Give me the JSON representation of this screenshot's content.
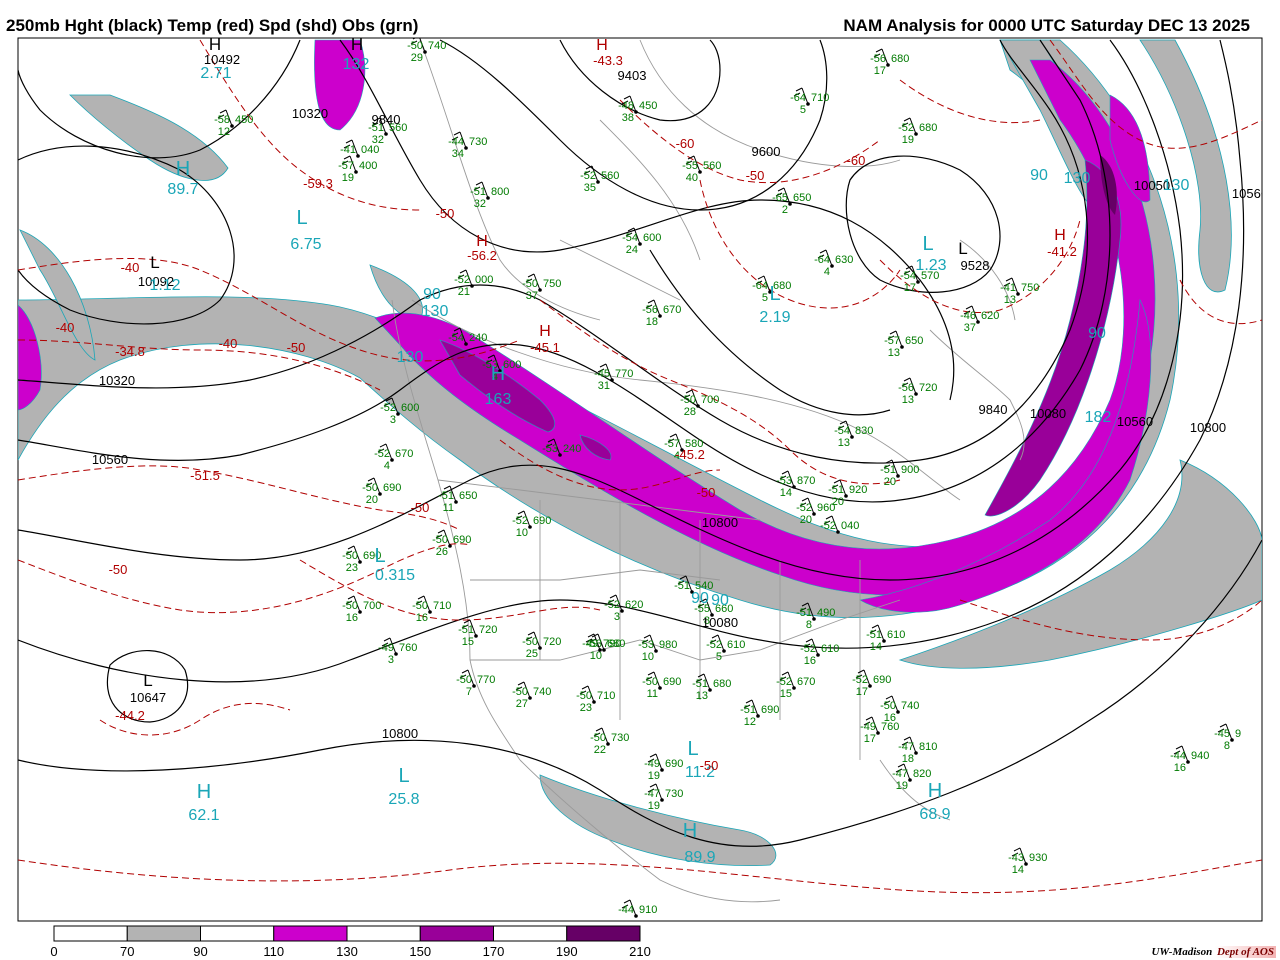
{
  "header": {
    "title_left": "250mb Hght (black) Temp (red) Spd (shd) Obs (grn)",
    "title_right": "NAM Analysis for 0000 UTC Saturday  DEC 13 2025"
  },
  "colors": {
    "height": "#000000",
    "temperature": "#b00000",
    "obs": "#007a00",
    "speed_label": "#1aa6b7",
    "speed_70": "#b3b3b3",
    "speed_110": "#cc00cc",
    "speed_150": "#990099",
    "speed_190": "#660066",
    "borders": "#9a9a9a"
  },
  "legend": {
    "ticks": [
      "0",
      "70",
      "90",
      "110",
      "130",
      "150",
      "170",
      "190",
      "210"
    ],
    "fills": [
      "#ffffff",
      "#b3b3b3",
      "#ffffff",
      "#cc00cc",
      "#ffffff",
      "#990099",
      "#ffffff",
      "#660066",
      "#ffffff"
    ]
  },
  "credit": {
    "org": "UW-Madison",
    "dept": "Dept of AOS"
  },
  "centers": [
    {
      "text": "H",
      "kind": "height"
    },
    {
      "text": "10492",
      "kind": "height"
    },
    {
      "text": "2.71",
      "kind": "speed"
    },
    {
      "text": "H",
      "kind": "speed"
    },
    {
      "text": "89.7",
      "kind": "speed"
    },
    {
      "text": "L",
      "kind": "speed"
    },
    {
      "text": "6.75",
      "kind": "speed"
    },
    {
      "text": "L",
      "kind": "height"
    },
    {
      "text": "10092",
      "kind": "height"
    },
    {
      "text": "1.12",
      "kind": "speed"
    },
    {
      "text": "10320",
      "kind": "height"
    },
    {
      "text": "10320",
      "kind": "height"
    },
    {
      "text": "10560",
      "kind": "height"
    },
    {
      "text": "L",
      "kind": "height"
    },
    {
      "text": "10647",
      "kind": "height"
    },
    {
      "text": "10800",
      "kind": "height"
    },
    {
      "text": "H",
      "kind": "speed"
    },
    {
      "text": "62.1",
      "kind": "speed"
    },
    {
      "text": "L",
      "kind": "speed"
    },
    {
      "text": "25.8",
      "kind": "speed"
    },
    {
      "text": "H",
      "kind": "speed"
    },
    {
      "text": "163",
      "kind": "speed"
    },
    {
      "text": "L",
      "kind": "speed"
    },
    {
      "text": "0.315",
      "kind": "speed"
    },
    {
      "text": "9600",
      "kind": "height"
    },
    {
      "text": "L",
      "kind": "speed"
    },
    {
      "text": "2.19",
      "kind": "speed"
    },
    {
      "text": "L",
      "kind": "speed"
    },
    {
      "text": "1.23",
      "kind": "speed"
    },
    {
      "text": "L",
      "kind": "height"
    },
    {
      "text": "9528",
      "kind": "height"
    },
    {
      "text": "9840",
      "kind": "height"
    },
    {
      "text": "10080",
      "kind": "height"
    },
    {
      "text": "10560",
      "kind": "height"
    },
    {
      "text": "10800",
      "kind": "height"
    },
    {
      "text": "10050",
      "kind": "height"
    },
    {
      "text": "10560",
      "kind": "height"
    },
    {
      "text": "10800",
      "kind": "height"
    },
    {
      "text": "10080",
      "kind": "height"
    },
    {
      "text": "L",
      "kind": "speed"
    },
    {
      "text": "11.2",
      "kind": "speed"
    },
    {
      "text": "H",
      "kind": "speed"
    },
    {
      "text": "89.9",
      "kind": "speed"
    },
    {
      "text": "H",
      "kind": "speed"
    },
    {
      "text": "68.9",
      "kind": "speed"
    },
    {
      "text": "9403",
      "kind": "height"
    },
    {
      "text": "9840",
      "kind": "height"
    },
    {
      "text": "H",
      "kind": "height"
    },
    {
      "text": "132",
      "kind": "speed"
    },
    {
      "text": "90",
      "kind": "speed"
    },
    {
      "text": "130",
      "kind": "speed"
    },
    {
      "text": "130",
      "kind": "speed"
    },
    {
      "text": "90",
      "kind": "speed"
    },
    {
      "text": "130",
      "kind": "speed"
    },
    {
      "text": "90",
      "kind": "speed"
    },
    {
      "text": "182",
      "kind": "speed"
    },
    {
      "text": "130",
      "kind": "speed"
    },
    {
      "text": "90",
      "kind": "speed"
    },
    {
      "text": "90",
      "kind": "speed"
    }
  ],
  "temps": [
    {
      "text": "-40"
    },
    {
      "text": "-34.8"
    },
    {
      "text": "-40"
    },
    {
      "text": "-40"
    },
    {
      "text": "-50"
    },
    {
      "text": "-51.5"
    },
    {
      "text": "-50"
    },
    {
      "text": "-50"
    },
    {
      "text": "-44.2"
    },
    {
      "text": "-59.3"
    },
    {
      "text": "H"
    },
    {
      "text": "-45.1"
    },
    {
      "text": "H"
    },
    {
      "text": "-56.2"
    },
    {
      "text": "-60"
    },
    {
      "text": "-50"
    },
    {
      "text": "-60"
    },
    {
      "text": "-50"
    },
    {
      "text": "-45.2"
    },
    {
      "text": "-50"
    },
    {
      "text": "H"
    },
    {
      "text": "-41.2"
    },
    {
      "text": "H"
    },
    {
      "text": "-43.3"
    },
    {
      "text": "-50"
    }
  ],
  "obs": [
    {
      "top": "-50",
      "hgt": "740",
      "bot": "29"
    },
    {
      "top": "-58",
      "hgt": "450",
      "bot": "12"
    },
    {
      "top": "-51",
      "hgt": "560",
      "bot": "32"
    },
    {
      "top": "-44",
      "hgt": "730",
      "bot": "34"
    },
    {
      "top": "-52",
      "hgt": "560",
      "bot": "35"
    },
    {
      "top": "-51",
      "hgt": "800",
      "bot": "32"
    },
    {
      "top": "-52",
      "hgt": "000",
      "bot": "21"
    },
    {
      "top": "-50",
      "hgt": "750",
      "bot": "37"
    },
    {
      "top": "-48",
      "hgt": "450",
      "bot": "38"
    },
    {
      "top": "-55",
      "hgt": "560",
      "bot": "40"
    },
    {
      "top": "-54",
      "hgt": "600",
      "bot": "24"
    },
    {
      "top": "-56",
      "hgt": "680",
      "bot": "17"
    },
    {
      "top": "-64",
      "hgt": "710",
      "bot": "5"
    },
    {
      "top": "-52",
      "hgt": "680",
      "bot": "19"
    },
    {
      "top": "-65",
      "hgt": "650",
      "bot": "2"
    },
    {
      "top": "-64",
      "hgt": "680",
      "bot": "5"
    },
    {
      "top": "-64",
      "hgt": "630",
      "bot": "4"
    },
    {
      "top": "-54",
      "hgt": "570",
      "bot": "17"
    },
    {
      "top": "-56",
      "hgt": "670",
      "bot": "18"
    },
    {
      "top": "-45",
      "hgt": "770",
      "bot": "31"
    },
    {
      "top": "-50",
      "hgt": "700",
      "bot": "28"
    },
    {
      "top": "-52",
      "hgt": "600",
      "bot": "3"
    },
    {
      "top": "-52",
      "hgt": "670",
      "bot": "4"
    },
    {
      "top": "-50",
      "hgt": "690",
      "bot": "20"
    },
    {
      "top": "-51",
      "hgt": "650",
      "bot": "11"
    },
    {
      "top": "-52",
      "hgt": "690",
      "bot": "10"
    },
    {
      "top": "-50",
      "hgt": "690",
      "bot": "23"
    },
    {
      "top": "-50",
      "hgt": "690",
      "bot": "26"
    },
    {
      "top": "-50",
      "hgt": "700",
      "bot": "16"
    },
    {
      "top": "-50",
      "hgt": "710",
      "bot": "16"
    },
    {
      "top": "-51",
      "hgt": "720",
      "bot": "15"
    },
    {
      "top": "-49",
      "hgt": "760",
      "bot": "3"
    },
    {
      "top": "-50",
      "hgt": "720",
      "bot": "25"
    },
    {
      "top": "-50",
      "hgt": "770",
      "bot": "7"
    },
    {
      "top": "-50",
      "hgt": "740",
      "bot": "27"
    },
    {
      "top": "-50",
      "hgt": "710",
      "bot": "23"
    },
    {
      "top": "-50",
      "hgt": "730",
      "bot": "22"
    },
    {
      "top": "-49",
      "hgt": "690",
      "bot": "19"
    },
    {
      "top": "-47",
      "hgt": "730",
      "bot": "19"
    },
    {
      "top": "-52",
      "hgt": "620",
      "bot": "3"
    },
    {
      "top": "-53",
      "hgt": "680",
      "bot": "10"
    },
    {
      "top": "-50",
      "hgt": "690",
      "bot": "11"
    },
    {
      "top": "-51",
      "hgt": "680",
      "bot": "13"
    },
    {
      "top": "-51",
      "hgt": "690",
      "bot": "12"
    },
    {
      "top": "-52",
      "hgt": "610",
      "bot": "5"
    },
    {
      "top": "-52",
      "hgt": "670",
      "bot": "15"
    },
    {
      "top": "-52",
      "hgt": "610",
      "bot": "16"
    },
    {
      "top": "-52",
      "hgt": "690",
      "bot": "17"
    },
    {
      "top": "-50",
      "hgt": "740",
      "bot": "16"
    },
    {
      "top": "-49",
      "hgt": "760",
      "bot": "17"
    },
    {
      "top": "-47",
      "hgt": "810",
      "bot": "18"
    },
    {
      "top": "-47",
      "hgt": "820",
      "bot": "19"
    },
    {
      "top": "-44",
      "hgt": "940",
      "bot": "16"
    },
    {
      "top": "-45",
      "hgt": "9",
      "bot": "8"
    },
    {
      "top": "-43",
      "hgt": "930",
      "bot": "14"
    },
    {
      "top": "-44",
      "hgt": "910",
      "bot": ""
    },
    {
      "top": "-51",
      "hgt": "610",
      "bot": "14"
    },
    {
      "top": "-51",
      "hgt": "490",
      "bot": "8"
    },
    {
      "top": "-51",
      "hgt": "900",
      "bot": "20"
    },
    {
      "top": "-51",
      "hgt": "920",
      "bot": "20"
    },
    {
      "top": "-52",
      "hgt": "960",
      "bot": "20"
    },
    {
      "top": "-52",
      "hgt": "040",
      "bot": ""
    },
    {
      "top": "-53",
      "hgt": "870",
      "bot": "14"
    },
    {
      "top": "-54",
      "hgt": "830",
      "bot": "13"
    },
    {
      "top": "-56",
      "hgt": "720",
      "bot": "13"
    },
    {
      "top": "-57",
      "hgt": "650",
      "bot": "13"
    },
    {
      "top": "-46",
      "hgt": "620",
      "bot": "37"
    },
    {
      "top": "-41",
      "hgt": "750",
      "bot": "13"
    },
    {
      "top": "-54",
      "hgt": "240",
      "bot": ""
    },
    {
      "top": "-53",
      "hgt": "240",
      "bot": ""
    },
    {
      "top": "-41",
      "hgt": "040",
      "bot": ""
    },
    {
      "top": "-57",
      "hgt": "400",
      "bot": "19"
    },
    {
      "top": "-53",
      "hgt": "600",
      "bot": "4"
    },
    {
      "top": "-57",
      "hgt": "580",
      "bot": "4"
    },
    {
      "top": "-49",
      "hgt": "790",
      "bot": ""
    },
    {
      "top": "-53",
      "hgt": "980",
      "bot": "10"
    },
    {
      "top": "-55",
      "hgt": "660",
      "bot": "8"
    },
    {
      "top": "-51",
      "hgt": "540",
      "bot": ""
    },
    {
      "top": "-54",
      "hgt": "510",
      "bot": "4"
    }
  ]
}
